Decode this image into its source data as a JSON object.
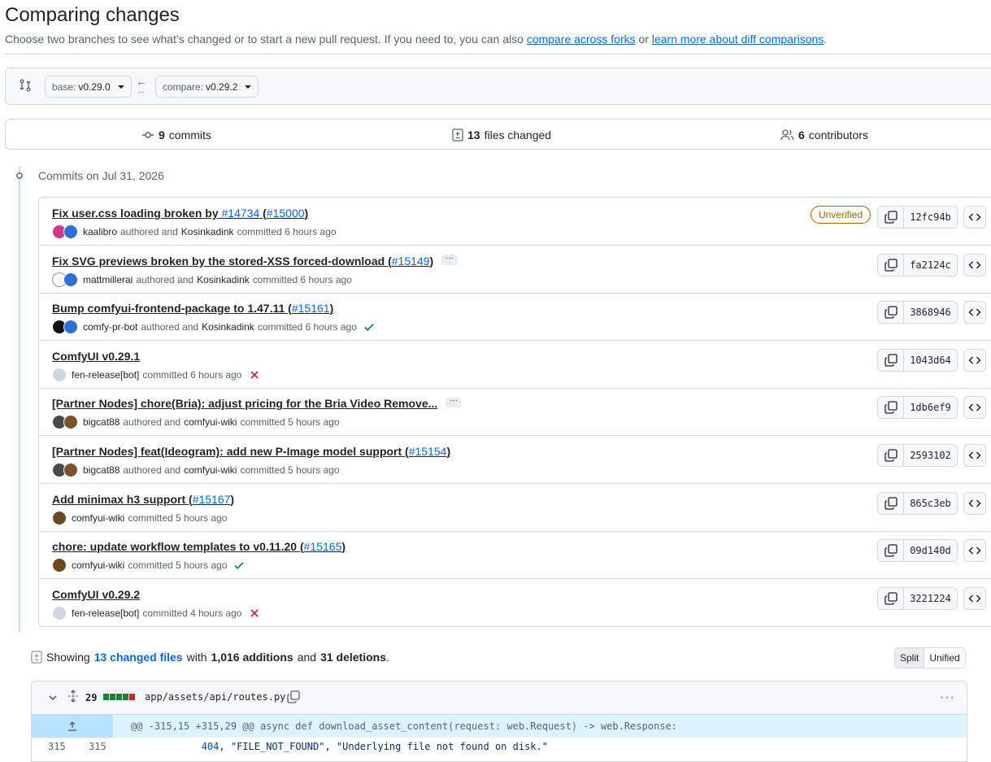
{
  "header": {
    "title": "Comparing changes",
    "subtitle_pre": "Choose two branches to see what’s changed or to start a new pull request. If you need to, you can also",
    "link_forks": "compare across forks",
    "subtitle_or": "or",
    "link_learn": "learn more about diff comparisons",
    "subtitle_end": "."
  },
  "range": {
    "base_label": "base:",
    "base_value": "v0.29.0",
    "compare_label": "compare:",
    "compare_value": "v0.29.2",
    "swap_arrow": "←",
    "swap_dots": "..."
  },
  "stats": {
    "commits_count": "9",
    "commits_label": "commits",
    "files_count": "13",
    "files_label": "files changed",
    "contributors_count": "6",
    "contributors_label": "contributors"
  },
  "timeline": {
    "commits_on": "Commits on Jul 31, 2026"
  },
  "commits": [
    {
      "title": "Fix user.css loading broken by",
      "pr1": "#14734",
      "mid": "(",
      "pr2": "#15000",
      "end": ")",
      "author": "kaalibro",
      "authored": "authored and",
      "committer": "Kosinkadink",
      "committed": "committed 6 hours ago",
      "badge": "Unverified",
      "sha": "12fc94b",
      "status": ""
    },
    {
      "title": "Fix SVG previews broken by the stored-XSS forced-download (",
      "pr1": "#15149",
      "mid": "",
      "pr2": "",
      "end": ")",
      "author": "mattmillerai",
      "authored": "authored and",
      "committer": "Kosinkadink",
      "committed": "committed 6 hours ago",
      "badge": "",
      "sha": "fa2124c",
      "status": "",
      "ellipsis": "···"
    },
    {
      "title": "Bump comfyui-frontend-package to 1.47.11 (",
      "pr1": "#15161",
      "mid": "",
      "pr2": "",
      "end": ")",
      "author": "comfy-pr-bot",
      "authored": "authored and",
      "committer": "Kosinkadink",
      "committed": "committed 6 hours ago",
      "badge": "",
      "sha": "3868946",
      "status": "check"
    },
    {
      "title": "ComfyUI v0.29.1",
      "pr1": "",
      "mid": "",
      "pr2": "",
      "end": "",
      "author": "fen-release[bot]",
      "authored": "",
      "committer": "",
      "committed": "committed 6 hours ago",
      "badge": "",
      "sha": "1043d64",
      "status": "x"
    },
    {
      "title": "[Partner Nodes] chore(Bria): adjust pricing for the Bria Video Remove...",
      "pr1": "",
      "mid": "",
      "pr2": "",
      "end": "",
      "author": "bigcat88",
      "authored": "authored and",
      "committer": "comfyui-wiki",
      "committed": "committed 5 hours ago",
      "badge": "",
      "sha": "1db6ef9",
      "status": "",
      "ellipsis": "···"
    },
    {
      "title": "[Partner Nodes] feat(Ideogram): add new P-Image model support (",
      "pr1": "#15154",
      "mid": "",
      "pr2": "",
      "end": ")",
      "author": "bigcat88",
      "authored": "authored and",
      "committer": "comfyui-wiki",
      "committed": "committed 5 hours ago",
      "badge": "",
      "sha": "2593102",
      "status": ""
    },
    {
      "title": "Add minimax h3 support (",
      "pr1": "#15167",
      "mid": "",
      "pr2": "",
      "end": ")",
      "author": "comfyui-wiki",
      "authored": "",
      "committer": "",
      "committed": "committed 5 hours ago",
      "badge": "",
      "sha": "865c3eb",
      "status": ""
    },
    {
      "title": "chore: update workflow templates to v0.11.20 (",
      "pr1": "#15165",
      "mid": "",
      "pr2": "",
      "end": ")",
      "author": "comfyui-wiki",
      "authored": "",
      "committer": "",
      "committed": "committed 5 hours ago",
      "badge": "",
      "sha": "09d140d",
      "status": "check"
    },
    {
      "title": "ComfyUI v0.29.2",
      "pr1": "",
      "mid": "",
      "pr2": "",
      "end": "",
      "author": "fen-release[bot]",
      "authored": "",
      "committer": "",
      "committed": "committed 4 hours ago",
      "badge": "",
      "sha": "3221224",
      "status": "x"
    }
  ],
  "files_summary": {
    "showing": "Showing",
    "changed_files": "13 changed files",
    "with": "with",
    "additions": "1,016 additions",
    "and": "and",
    "deletions": "31 deletions",
    "end": ".",
    "split": "Split",
    "unified": "Unified"
  },
  "file": {
    "changes": "29",
    "path": "app/assets/api/routes.py",
    "menu": "···",
    "hunk": "@@ -315,15 +315,29 @@ async def download_asset_content(request: web.Request) -> web.Response:",
    "line_old": "315",
    "line_new": "315",
    "code_indent": "            ",
    "code_num": "404",
    "code_rest": ", ",
    "code_str1": "\"FILE_NOT_FOUND\"",
    "code_sep": ", ",
    "code_str2": "\"Underlying file not found on disk.\""
  },
  "colors": {
    "link": "#0969da",
    "addition": "#1a7f37",
    "deletion": "#cf222e",
    "unverified": "#9a6700",
    "hunk_bg": "#ddf4ff"
  }
}
